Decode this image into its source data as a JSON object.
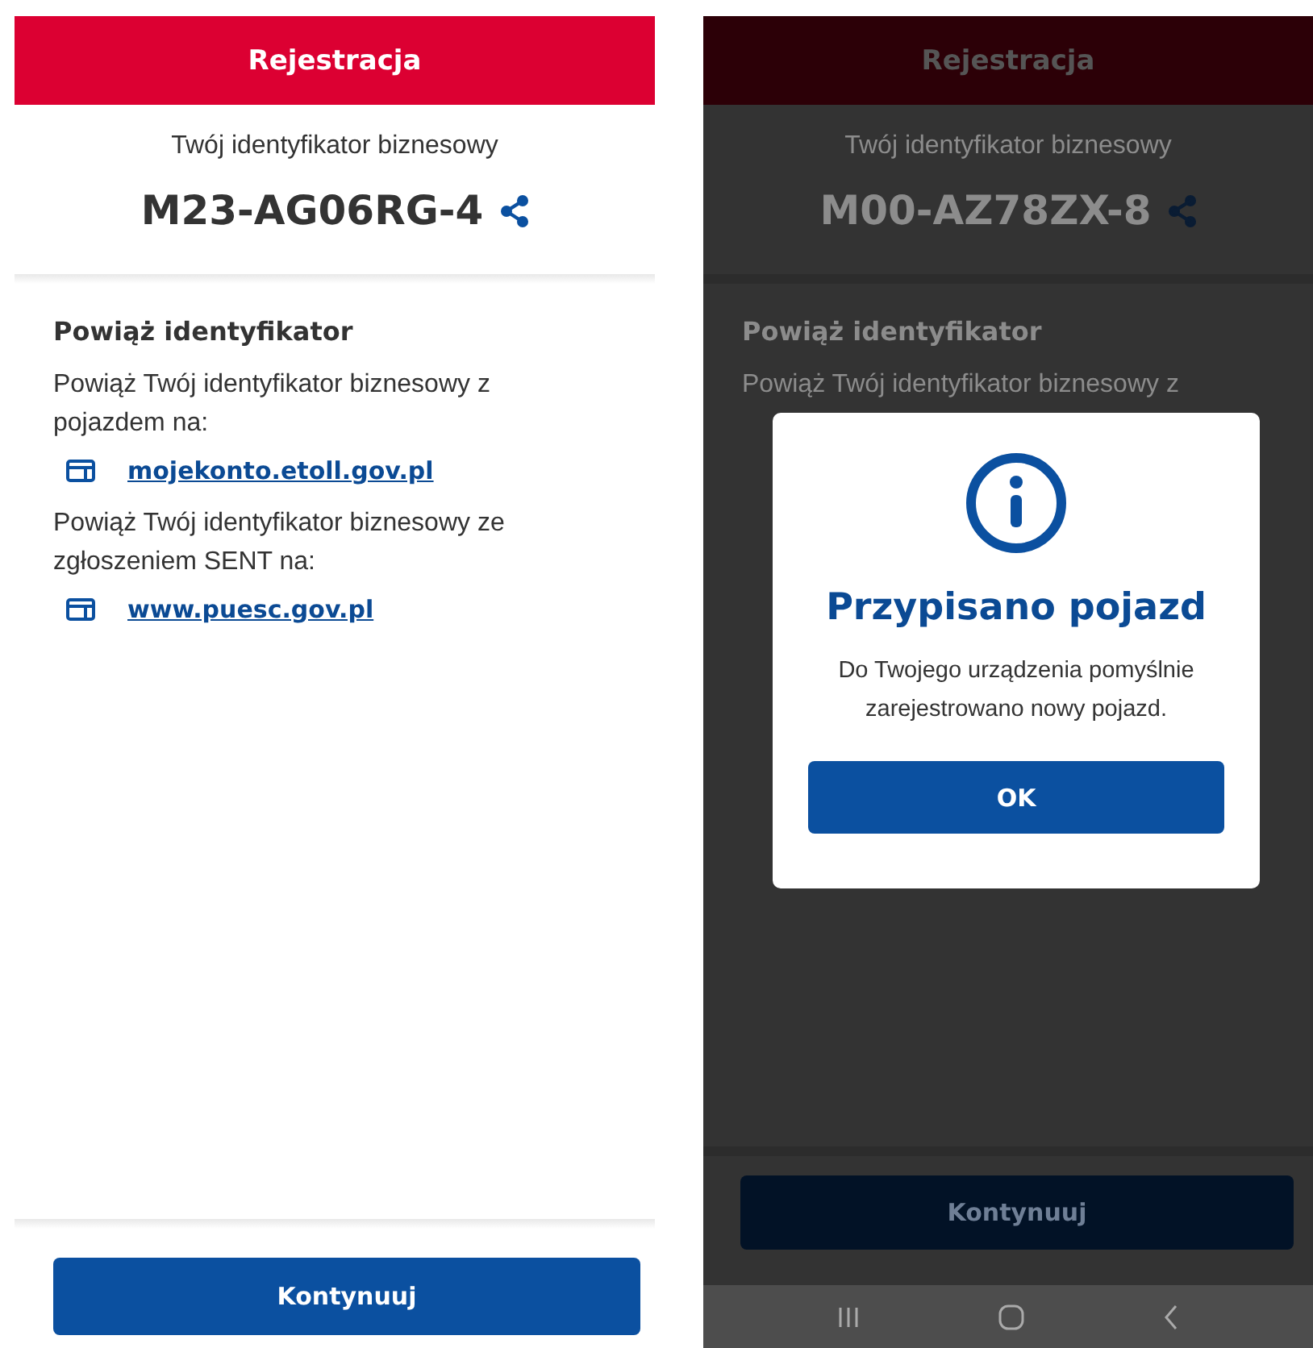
{
  "screens": [
    {
      "dimmed": false,
      "header": {
        "title": "Rejestracja"
      },
      "id_label": "Twój identyfikator biznesowy",
      "business_id": "M23-AG06RG-4",
      "section": {
        "title": "Powiąż identyfikator",
        "items": [
          {
            "text": "Powiąż Twój identyfikator biznesowy z pojazdem na:",
            "link": "mojekonto.etoll.gov.pl"
          },
          {
            "text": "Powiąż Twój identyfikator biznesowy ze zgłoszeniem SENT na:",
            "link": "www.puesc.gov.pl"
          }
        ]
      },
      "button": "Kontynuuj"
    },
    {
      "dimmed": true,
      "system_nav": true,
      "header": {
        "title": "Rejestracja"
      },
      "id_label": "Twój identyfikator biznesowy",
      "business_id": "M00-AZ78ZX-8",
      "section": {
        "title": "Powiąż identyfikator",
        "items": [
          {
            "text": "Powiąż Twój identyfikator biznesowy z"
          }
        ]
      },
      "button": "Kontynuuj",
      "dialog": {
        "title": "Przypisano pojazd",
        "message": "Do Twojego urządzenia pomyślnie zarejestrowano nowy pojazd.",
        "button": "OK"
      }
    }
  ]
}
